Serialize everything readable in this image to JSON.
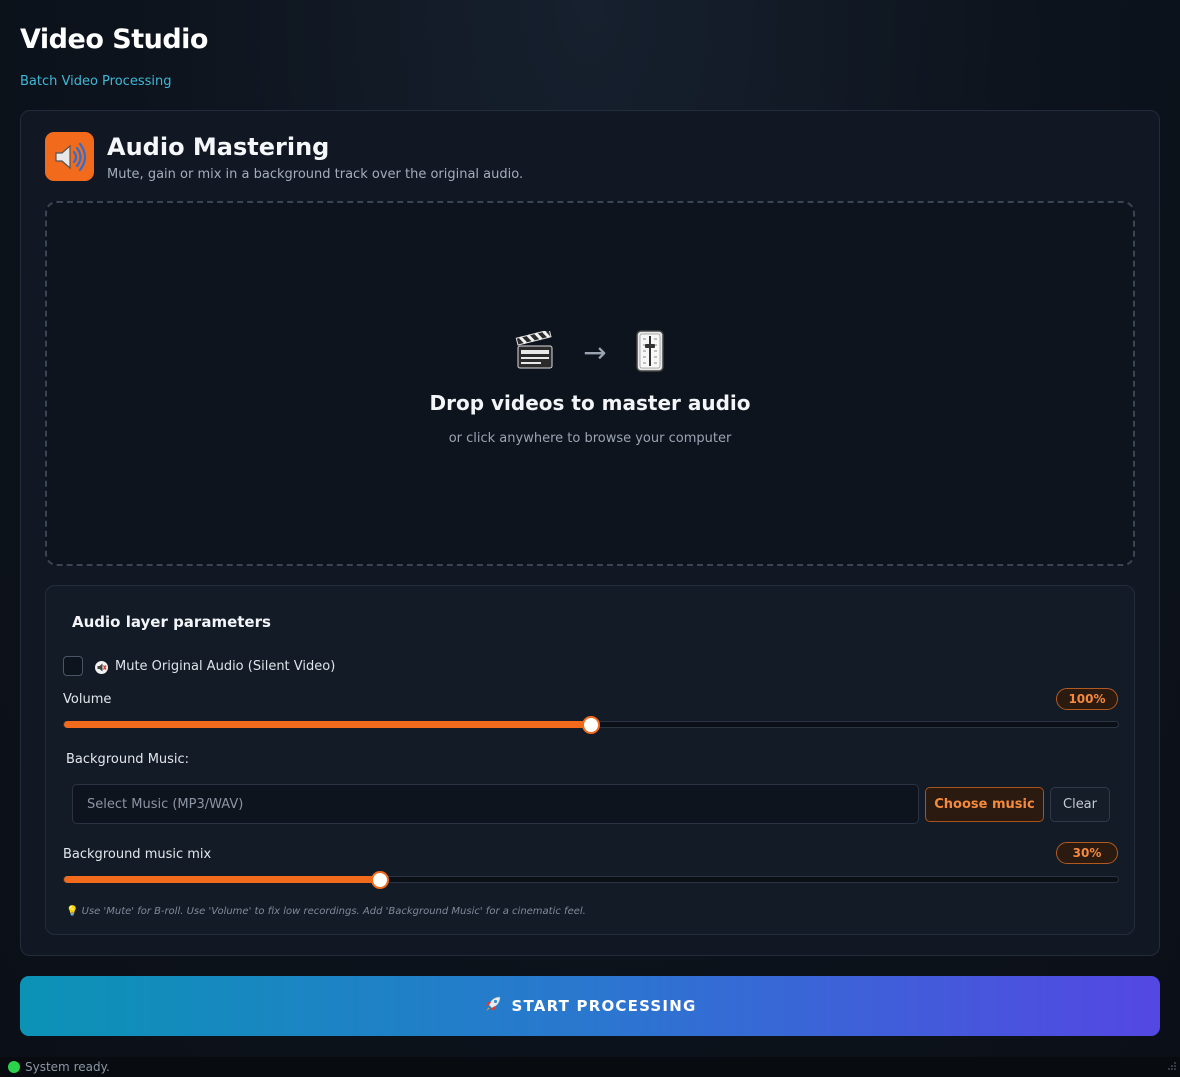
{
  "header": {
    "title": "Video Studio",
    "subtitle": "Batch Video Processing"
  },
  "panel": {
    "icon": "speaker-icon",
    "title": "Audio Mastering",
    "description": "Mute, gain or mix in a background track over the original audio."
  },
  "dropzone": {
    "icons": [
      "clapperboard-icon",
      "arrow-right-icon",
      "mixer-fader-icon"
    ],
    "title": "Drop videos to master audio",
    "subtitle": "or click anywhere to browse your computer"
  },
  "params": {
    "title": "Audio layer parameters",
    "mute": {
      "label": "Mute Original Audio (Silent Video)",
      "checked": false,
      "icon": "muted-speaker-icon"
    },
    "volume": {
      "label": "Volume",
      "value_text": "100%",
      "fraction": 0.5
    },
    "background_music": {
      "label": "Background Music:",
      "placeholder": "Select Music (MP3/WAV)",
      "choose_label": "Choose music",
      "clear_label": "Clear"
    },
    "mix": {
      "label": "Background music mix",
      "value_text": "30%",
      "fraction": 0.3
    },
    "hint": "Use 'Mute' for B-roll. Use 'Volume' to fix low recordings. Add 'Background Music' for a cinematic feel.",
    "hint_icon": "lightbulb-icon"
  },
  "actions": {
    "start_label": "START PROCESSING",
    "start_icon": "rocket-icon"
  },
  "status": {
    "text": "System ready.",
    "color": "#2bd34a"
  },
  "colors": {
    "accent": "#f26a1b",
    "link": "#3fb8d8"
  }
}
